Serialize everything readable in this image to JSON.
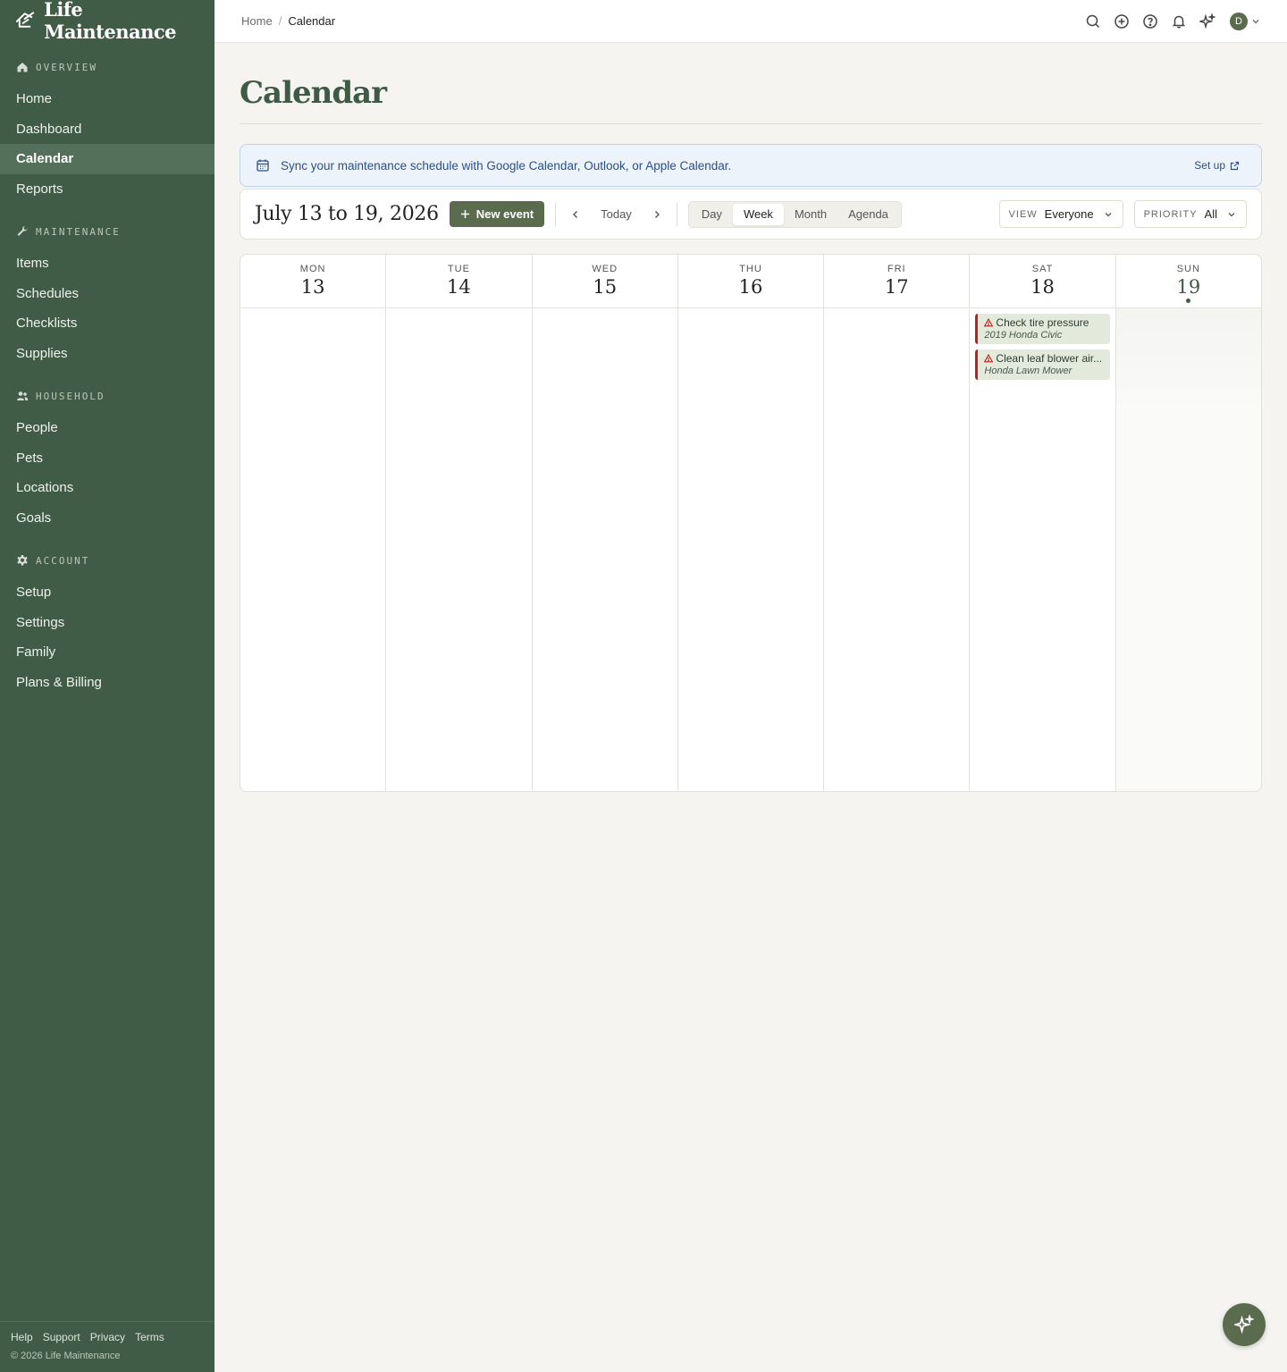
{
  "brand": {
    "name": "Life Maintenance"
  },
  "sidebar": {
    "sections": [
      {
        "title": "OVERVIEW",
        "icon": "home-icon",
        "items": [
          "Home",
          "Dashboard",
          "Calendar",
          "Reports"
        ]
      },
      {
        "title": "MAINTENANCE",
        "icon": "wrench-icon",
        "items": [
          "Items",
          "Schedules",
          "Checklists",
          "Supplies"
        ]
      },
      {
        "title": "HOUSEHOLD",
        "icon": "people-icon",
        "items": [
          "People",
          "Pets",
          "Locations",
          "Goals"
        ]
      },
      {
        "title": "ACCOUNT",
        "icon": "gear-icon",
        "items": [
          "Setup",
          "Settings",
          "Family",
          "Plans & Billing"
        ]
      }
    ],
    "active_item": "Calendar",
    "footer_links": [
      "Help",
      "Support",
      "Privacy",
      "Terms"
    ],
    "copyright": "© 2026 Life Maintenance"
  },
  "breadcrumb": {
    "home": "Home",
    "separator": "/",
    "current": "Calendar"
  },
  "user": {
    "initial": "D"
  },
  "page": {
    "title": "Calendar"
  },
  "sync": {
    "text": "Sync your maintenance schedule with Google Calendar, Outlook, or Apple Calendar.",
    "action": "Set up"
  },
  "toolbar": {
    "range": "July 13 to 19, 2026",
    "new_event": "New event",
    "today": "Today",
    "views": [
      "Day",
      "Week",
      "Month",
      "Agenda"
    ],
    "active_view": "Week",
    "filter_view_label": "VIEW",
    "filter_view_value": "Everyone",
    "filter_priority_label": "PRIORITY",
    "filter_priority_value": "All"
  },
  "week": {
    "days": [
      {
        "dow": "MON",
        "num": "13",
        "today": false,
        "events": []
      },
      {
        "dow": "TUE",
        "num": "14",
        "today": false,
        "events": []
      },
      {
        "dow": "WED",
        "num": "15",
        "today": false,
        "events": []
      },
      {
        "dow": "THU",
        "num": "16",
        "today": false,
        "events": []
      },
      {
        "dow": "FRI",
        "num": "17",
        "today": false,
        "events": []
      },
      {
        "dow": "SAT",
        "num": "18",
        "today": false,
        "events": [
          {
            "title": "Check tire pressure",
            "subtitle": "2019 Honda Civic",
            "priority_icon": "warning-icon"
          },
          {
            "title": "Clean leaf blower air...",
            "subtitle": "Honda Lawn Mower",
            "priority_icon": "warning-icon"
          }
        ]
      },
      {
        "dow": "SUN",
        "num": "19",
        "today": true,
        "events": []
      }
    ]
  },
  "colors": {
    "sidebar": "#415c46",
    "accent": "#5a6b4e",
    "title": "#3f5a45",
    "overdue": "#b3261e",
    "event_bg": "#e3eadc"
  }
}
